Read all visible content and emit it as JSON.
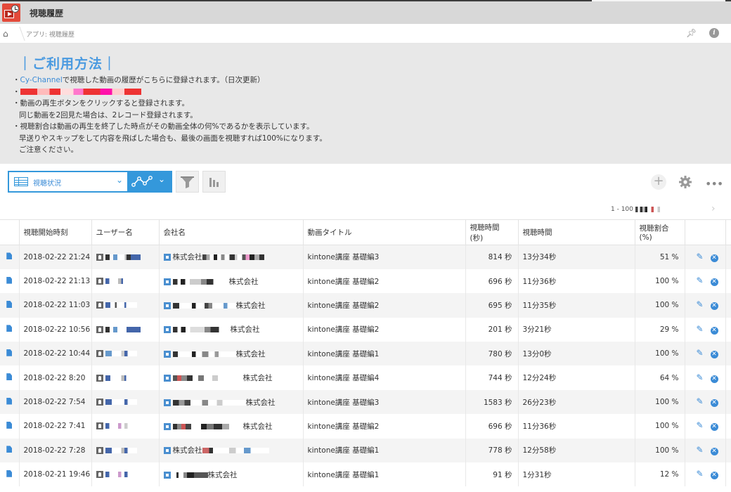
{
  "app": {
    "title": "視聴履歴",
    "breadcrumb": "アプリ: 視聴履歴"
  },
  "usage": {
    "title": "｜ご利用方法｜",
    "line1_accent": "Cy-Channel",
    "line1_rest": "で視聴した動画の履歴がこちらに登録されます。（日次更新）",
    "bullet": "・",
    "line3": "動画の再生ボタンをクリックすると登録されます。",
    "line4": "同じ動画を2回見た場合は、2レコード登録されます。",
    "line5": "視聴割合は動画の再生を終了した時点がその動画全体の何%であるかを表示しています。",
    "line6": "早送りやスキップをして内容を飛ばした場合も、最後の画面を視聴すれば100%になります。",
    "line7": "ご注意ください。"
  },
  "toolbar": {
    "view_label": "視聴状況"
  },
  "pager": {
    "range": "1 - 100"
  },
  "table": {
    "headers": [
      "視聴開始時刻",
      "ユーザー名",
      "会社名",
      "動画タイトル",
      "視聴時間(秒)",
      "視聴時間",
      "視聴割合(%)"
    ],
    "rows": [
      {
        "time": "2018-02-22 21:24",
        "company_suffix": "株式会社",
        "title": "kintone講座 基礎編3",
        "sec": "814 秒",
        "dur": "13分34秒",
        "pct": "51 %"
      },
      {
        "time": "2018-02-22 21:13",
        "company_suffix": "株式会社",
        "title": "kintone講座 基礎編2",
        "sec": "696 秒",
        "dur": "11分36秒",
        "pct": "100 %"
      },
      {
        "time": "2018-02-22 11:03",
        "company_suffix": "株式会社",
        "title": "kintone講座 基礎編2",
        "sec": "695 秒",
        "dur": "11分35秒",
        "pct": "100 %"
      },
      {
        "time": "2018-02-22 10:56",
        "company_suffix": "株式会社",
        "title": "kintone講座 基礎編2",
        "sec": "201 秒",
        "dur": "3分21秒",
        "pct": "29 %"
      },
      {
        "time": "2018-02-22 10:44",
        "company_suffix": "株式会社",
        "title": "kintone講座 基礎編1",
        "sec": "780 秒",
        "dur": "13分0秒",
        "pct": "100 %"
      },
      {
        "time": "2018-02-22 8:20",
        "company_suffix": "株式会社",
        "title": "kintone講座 基礎編4",
        "sec": "744 秒",
        "dur": "12分24秒",
        "pct": "64 %"
      },
      {
        "time": "2018-02-22 7:54",
        "company_suffix": "株式会社",
        "title": "kintone講座 基礎編3",
        "sec": "1583 秒",
        "dur": "26分23秒",
        "pct": "100 %"
      },
      {
        "time": "2018-02-22 7:41",
        "company_suffix": "株式会社",
        "title": "kintone講座 基礎編2",
        "sec": "696 秒",
        "dur": "11分36秒",
        "pct": "100 %"
      },
      {
        "time": "2018-02-22 7:28",
        "company_suffix": "株式会社",
        "title": "kintone講座 基礎編1",
        "sec": "778 秒",
        "dur": "12分58秒",
        "pct": "100 %"
      },
      {
        "time": "2018-02-21 19:46",
        "company_suffix": "株式会社",
        "title": "kintone講座 基礎編1",
        "sec": "91 秒",
        "dur": "1分31秒",
        "pct": "12 %"
      }
    ]
  },
  "colors": {
    "accent": "#3498db",
    "header_bg": "#d8d8d8",
    "panel_bg": "#e8e8e8"
  },
  "icons": [
    "app-icon",
    "home-icon",
    "pin-icon",
    "info-icon",
    "list-icon",
    "graph-icon",
    "filter-icon",
    "chart-icon",
    "plus-icon",
    "gear-icon",
    "more-icon",
    "document-icon",
    "user-icon",
    "organization-icon",
    "edit-icon",
    "delete-icon"
  ]
}
